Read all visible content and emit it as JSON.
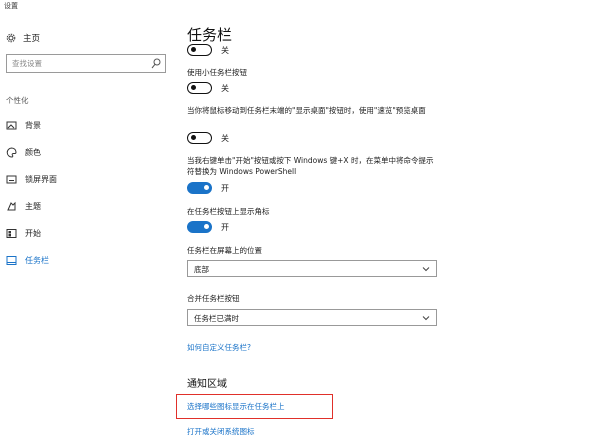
{
  "window": {
    "title": "设置"
  },
  "sidebar": {
    "home_label": "主页",
    "search_placeholder": "查找设置",
    "section_label": "个性化",
    "items": [
      {
        "label": "背景",
        "icon": "picture-icon"
      },
      {
        "label": "颜色",
        "icon": "palette-icon"
      },
      {
        "label": "锁屏界面",
        "icon": "lock-screen-icon"
      },
      {
        "label": "主题",
        "icon": "theme-icon"
      },
      {
        "label": "开始",
        "icon": "start-icon"
      },
      {
        "label": "任务栏",
        "icon": "taskbar-icon",
        "active": true
      }
    ]
  },
  "main": {
    "title": "任务栏",
    "settings": [
      {
        "label": "",
        "state": "关",
        "on": false
      },
      {
        "label": "使用小任务栏按钮",
        "state": "关",
        "on": false
      },
      {
        "label": "当你将鼠标移动到任务栏末端的\"显示桌面\"按钮时，使用\"速览\"预览桌面",
        "state": "关",
        "on": false
      },
      {
        "label": "当我右键单击\"开始\"按钮或按下 Windows 键+X 时，在菜单中将命令提示符替换为 Windows PowerShell",
        "state": "开",
        "on": true
      },
      {
        "label": "在任务栏按钮上显示角标",
        "state": "开",
        "on": true
      }
    ],
    "position": {
      "label": "任务栏在屏幕上的位置",
      "value": "底部"
    },
    "combine": {
      "label": "合并任务栏按钮",
      "value": "任务栏已满时"
    },
    "customize_link": "如何自定义任务栏?",
    "notification": {
      "heading": "通知区域",
      "select_icons_link": "选择哪些图标显示在任务栏上",
      "system_icons_link": "打开或关闭系统图标"
    }
  },
  "colors": {
    "accent": "#1a73c8",
    "highlight": "#e0302a"
  }
}
